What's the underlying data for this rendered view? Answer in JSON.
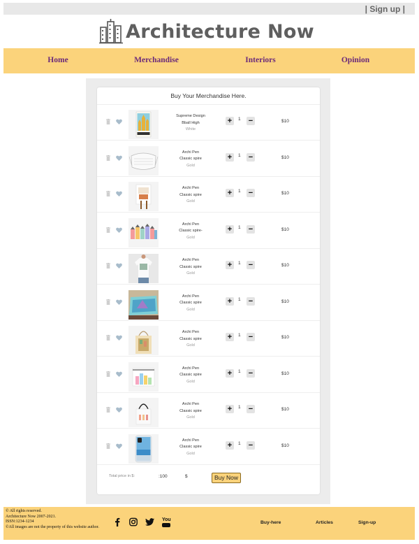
{
  "header": {
    "signup_label": "| Sign up |",
    "site_title": "Architecture Now"
  },
  "nav": {
    "items": [
      "Home",
      "Merchandise",
      "Interiors",
      "Opinion"
    ]
  },
  "cart": {
    "heading": "Buy Your Merchandise Here.",
    "items": [
      {
        "name": "Supreme Design",
        "variant": "Bball High",
        "color": "White",
        "qty": "1",
        "price": "$10",
        "thumb": "barcelona-poster"
      },
      {
        "name": "Archi Pen",
        "variant": "Classic spire",
        "color": "Gold",
        "qty": "1",
        "price": "$10",
        "thumb": "face-mask"
      },
      {
        "name": "Archi Pen",
        "variant": "Classic spire",
        "color": "Gold",
        "qty": "1",
        "price": "$10",
        "thumb": "framed-print"
      },
      {
        "name": "Archi Pen",
        "variant": "Classic spire-",
        "color": "Gold",
        "qty": "1",
        "price": "$10",
        "thumb": "houses-sticker"
      },
      {
        "name": "Archi Pen",
        "variant": "Classic spire",
        "color": "Gold",
        "qty": "1",
        "price": "$10",
        "thumb": "t-shirt"
      },
      {
        "name": "Archi Pen",
        "variant": "Classic spire",
        "color": "Gold",
        "qty": "1",
        "price": "$10",
        "thumb": "duvet-cover"
      },
      {
        "name": "Archi Pen",
        "variant": "Classic spire",
        "color": "Gold",
        "qty": "1",
        "price": "$10",
        "thumb": "tote-bag"
      },
      {
        "name": "Archi Pen",
        "variant": "Classic spire",
        "color": "Gold",
        "qty": "1",
        "price": "$10",
        "thumb": "zipper-pouch"
      },
      {
        "name": "Archi Pen",
        "variant": "Classic spire",
        "color": "Gold",
        "qty": "1",
        "price": "$10",
        "thumb": "black-tote"
      },
      {
        "name": "Archi Pen",
        "variant": "Classic spire",
        "color": "Gold",
        "qty": "1",
        "price": "$10",
        "thumb": "phone-case"
      }
    ],
    "total_label": "Total price in $:",
    "total_value": ":100",
    "currency": "$",
    "buy_label": "Buy Now"
  },
  "footer": {
    "copyright": [
      "© All rights reserved.",
      "Architecture Now 2007-2021.",
      "ISSN:1234-1234",
      "©All images are not the property of this website author."
    ],
    "social_icons": [
      "facebook-icon",
      "instagram-icon",
      "twitter-icon",
      "youtube-icon"
    ],
    "youtube_glyph": "You",
    "links": [
      "Buy-here",
      "Articles",
      "Sign-up"
    ]
  },
  "colors": {
    "accent": "#fbd37b",
    "nav_text": "#6b2a7a",
    "panel": "#ececec",
    "heart": "#a8bccb"
  }
}
